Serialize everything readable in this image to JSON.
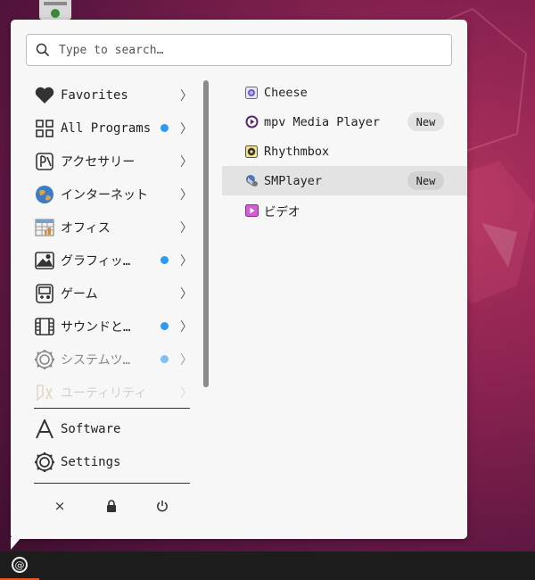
{
  "search": {
    "placeholder": "Type to search…",
    "value": ""
  },
  "categories": [
    {
      "label": "Favorites",
      "icon": "heart-icon",
      "dot": false
    },
    {
      "label": "All Programs",
      "icon": "grid-icon",
      "dot": true
    },
    {
      "label": "アクセサリー",
      "icon": "accessories-icon",
      "dot": false
    },
    {
      "label": "インターネット",
      "icon": "globe-icon",
      "dot": false
    },
    {
      "label": "オフィス",
      "icon": "office-icon",
      "dot": false
    },
    {
      "label": "グラフィッ…",
      "icon": "image-icon",
      "dot": true
    },
    {
      "label": "ゲーム",
      "icon": "gamepad-icon",
      "dot": false
    },
    {
      "label": "サウンドと…",
      "icon": "film-icon",
      "dot": true
    },
    {
      "label": "システムツ…",
      "icon": "system-gear-icon",
      "dot": true
    },
    {
      "label": "ユーティリティ",
      "icon": "utilities-icon",
      "dot": false
    }
  ],
  "chevron": "〉",
  "apps": [
    {
      "label": "Cheese",
      "icon": "cheese-icon",
      "badge": ""
    },
    {
      "label": "mpv Media Player",
      "icon": "mpv-icon",
      "badge": "New"
    },
    {
      "label": "Rhythmbox",
      "icon": "rhythmbox-icon",
      "badge": ""
    },
    {
      "label": "SMPlayer",
      "icon": "smplayer-icon",
      "badge": "New"
    },
    {
      "label": "ビデオ",
      "icon": "videos-icon",
      "badge": ""
    }
  ],
  "bottom": {
    "software": "Software",
    "settings": "Settings"
  },
  "session": {
    "close": "×",
    "lock": "lock-icon",
    "power": "power-icon"
  },
  "colors": {
    "accent_dot": "#2b9af3",
    "panel_accent": "#e95420",
    "menu_bg": "#f7f7f7"
  }
}
